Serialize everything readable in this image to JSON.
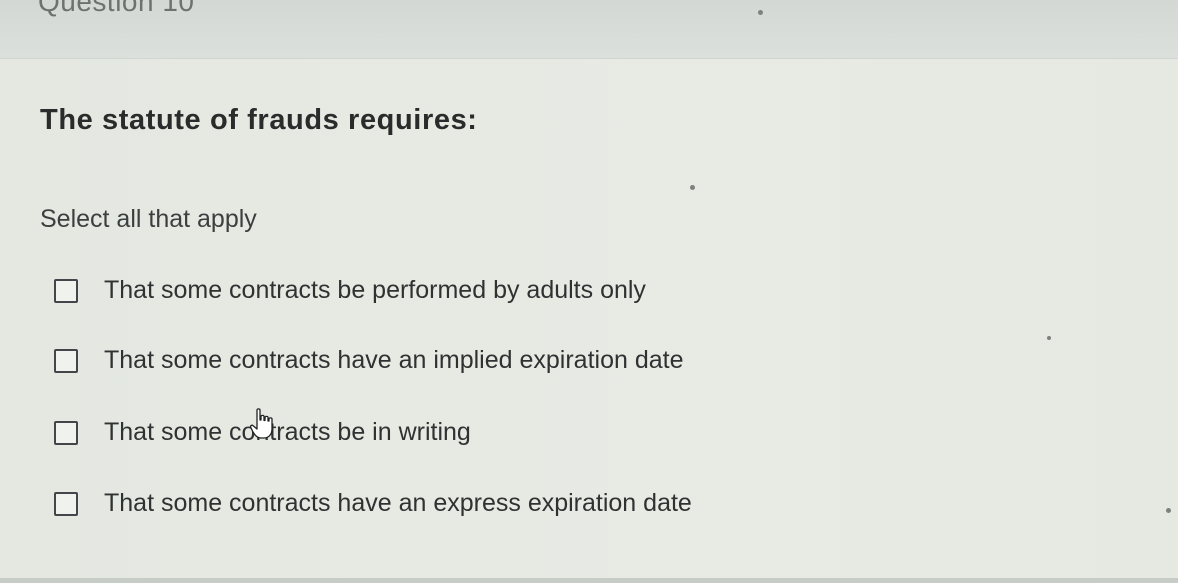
{
  "header": {
    "title": "Question 10"
  },
  "question": {
    "text": "The statute of frauds requires:",
    "instruction": "Select all that apply"
  },
  "options": [
    {
      "label": "That some contracts be performed by adults only",
      "checked": false
    },
    {
      "label": "That some contracts have an implied expiration date",
      "checked": false
    },
    {
      "label": "That some contracts be in writing",
      "checked": false
    },
    {
      "label": "That some contracts have an express expiration date",
      "checked": false
    }
  ],
  "cursor": {
    "icon": "hand-pointer-icon"
  }
}
